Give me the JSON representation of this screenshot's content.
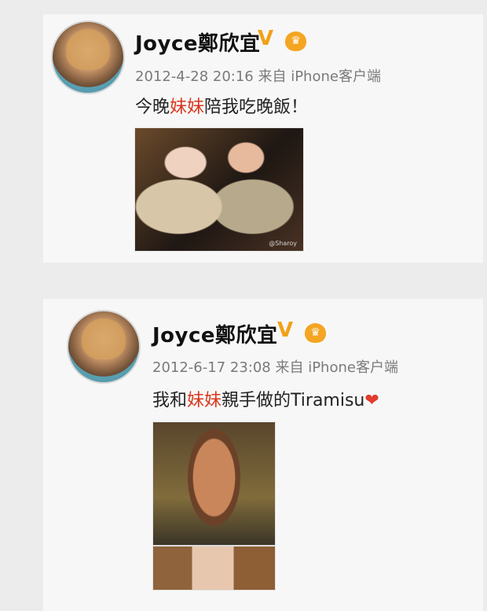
{
  "posts": [
    {
      "author": {
        "name": "Joyce鄭欣宜",
        "verified_badge": "V",
        "vip_badge": "♛"
      },
      "meta": "2012-4-28 20:16 来自 iPhone客户端",
      "content": {
        "prefix": "今晚",
        "highlight": "妹妹",
        "suffix": "陪我吃晚飯！"
      },
      "image": {
        "watermark": "@Sharoy"
      }
    },
    {
      "author": {
        "name": "Joyce鄭欣宜",
        "verified_badge": "V",
        "vip_badge": "♛"
      },
      "meta": "2012-6-17 23:08 来自 iPhone客户端",
      "content": {
        "prefix": "我和",
        "highlight": "妹妹",
        "suffix": "親手做的Tiramisu",
        "emoji": "❤"
      }
    }
  ],
  "colors": {
    "background": "#ececec",
    "card": "#f7f7f7",
    "highlight": "#d8361c",
    "meta": "#7a7a7a",
    "badge": "#f1a117"
  }
}
